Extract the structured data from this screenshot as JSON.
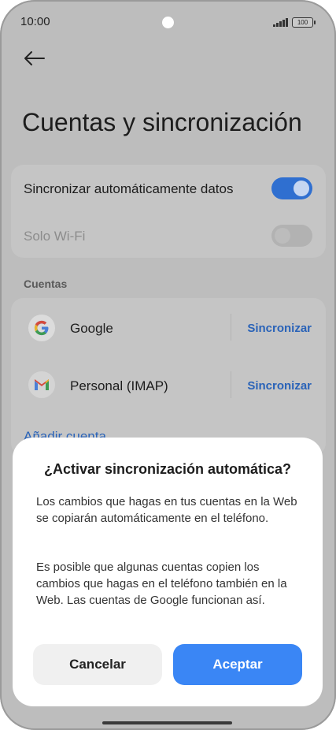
{
  "status_bar": {
    "time": "10:00",
    "battery": "100"
  },
  "page": {
    "title": "Cuentas y sincronización"
  },
  "sync_settings": {
    "auto_sync_label": "Sincronizar automáticamente datos",
    "auto_sync_on": true,
    "wifi_only_label": "Solo Wi-Fi",
    "wifi_only_on": false
  },
  "accounts_section": {
    "label": "Cuentas",
    "items": [
      {
        "name": "Google",
        "action": "Sincronizar",
        "icon": "google-icon"
      },
      {
        "name": "Personal (IMAP)",
        "action": "Sincronizar",
        "icon": "gmail-icon"
      }
    ],
    "add_account": "Añadir cuenta"
  },
  "dialog": {
    "title": "¿Activar sincronización automática?",
    "paragraph1": "Los cambios que hagas en tus cuentas en la Web se copiarán automáticamente en el teléfono.",
    "paragraph2": "Es posible que algunas cuentas copien los cambios que hagas en el teléfono también en la Web. Las cuentas de Google funcionan así.",
    "cancel_label": "Cancelar",
    "accept_label": "Aceptar"
  },
  "colors": {
    "accent": "#3a86f5",
    "link": "#2a63b8",
    "toggle_on": "#2f6fd0"
  }
}
